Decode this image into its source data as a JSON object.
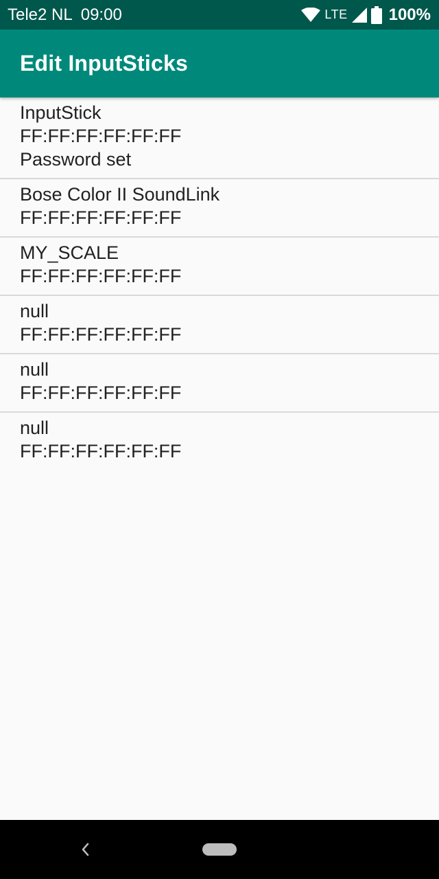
{
  "status_bar": {
    "carrier": "Tele2 NL",
    "time": "09:00",
    "network": "LTE",
    "battery": "100%"
  },
  "app_bar": {
    "title": "Edit InputSticks"
  },
  "devices": [
    {
      "name": "InputStick",
      "address": "FF:FF:FF:FF:FF:FF",
      "status": "Password set"
    },
    {
      "name": "Bose Color II SoundLink",
      "address": "FF:FF:FF:FF:FF:FF"
    },
    {
      "name": "MY_SCALE",
      "address": "FF:FF:FF:FF:FF:FF"
    },
    {
      "name": "null",
      "address": "FF:FF:FF:FF:FF:FF"
    },
    {
      "name": "null",
      "address": "FF:FF:FF:FF:FF:FF"
    },
    {
      "name": "null",
      "address": "FF:FF:FF:FF:FF:FF"
    }
  ],
  "icons": {
    "wifi": "wifi-icon",
    "signal": "signal-icon",
    "battery": "battery-icon",
    "back": "back-icon",
    "home": "home-icon"
  },
  "colors": {
    "status_bar": "#00574b",
    "app_bar": "#00897b",
    "background": "#fafafa",
    "divider": "#d9d9d9",
    "nav_bar": "#000000"
  }
}
